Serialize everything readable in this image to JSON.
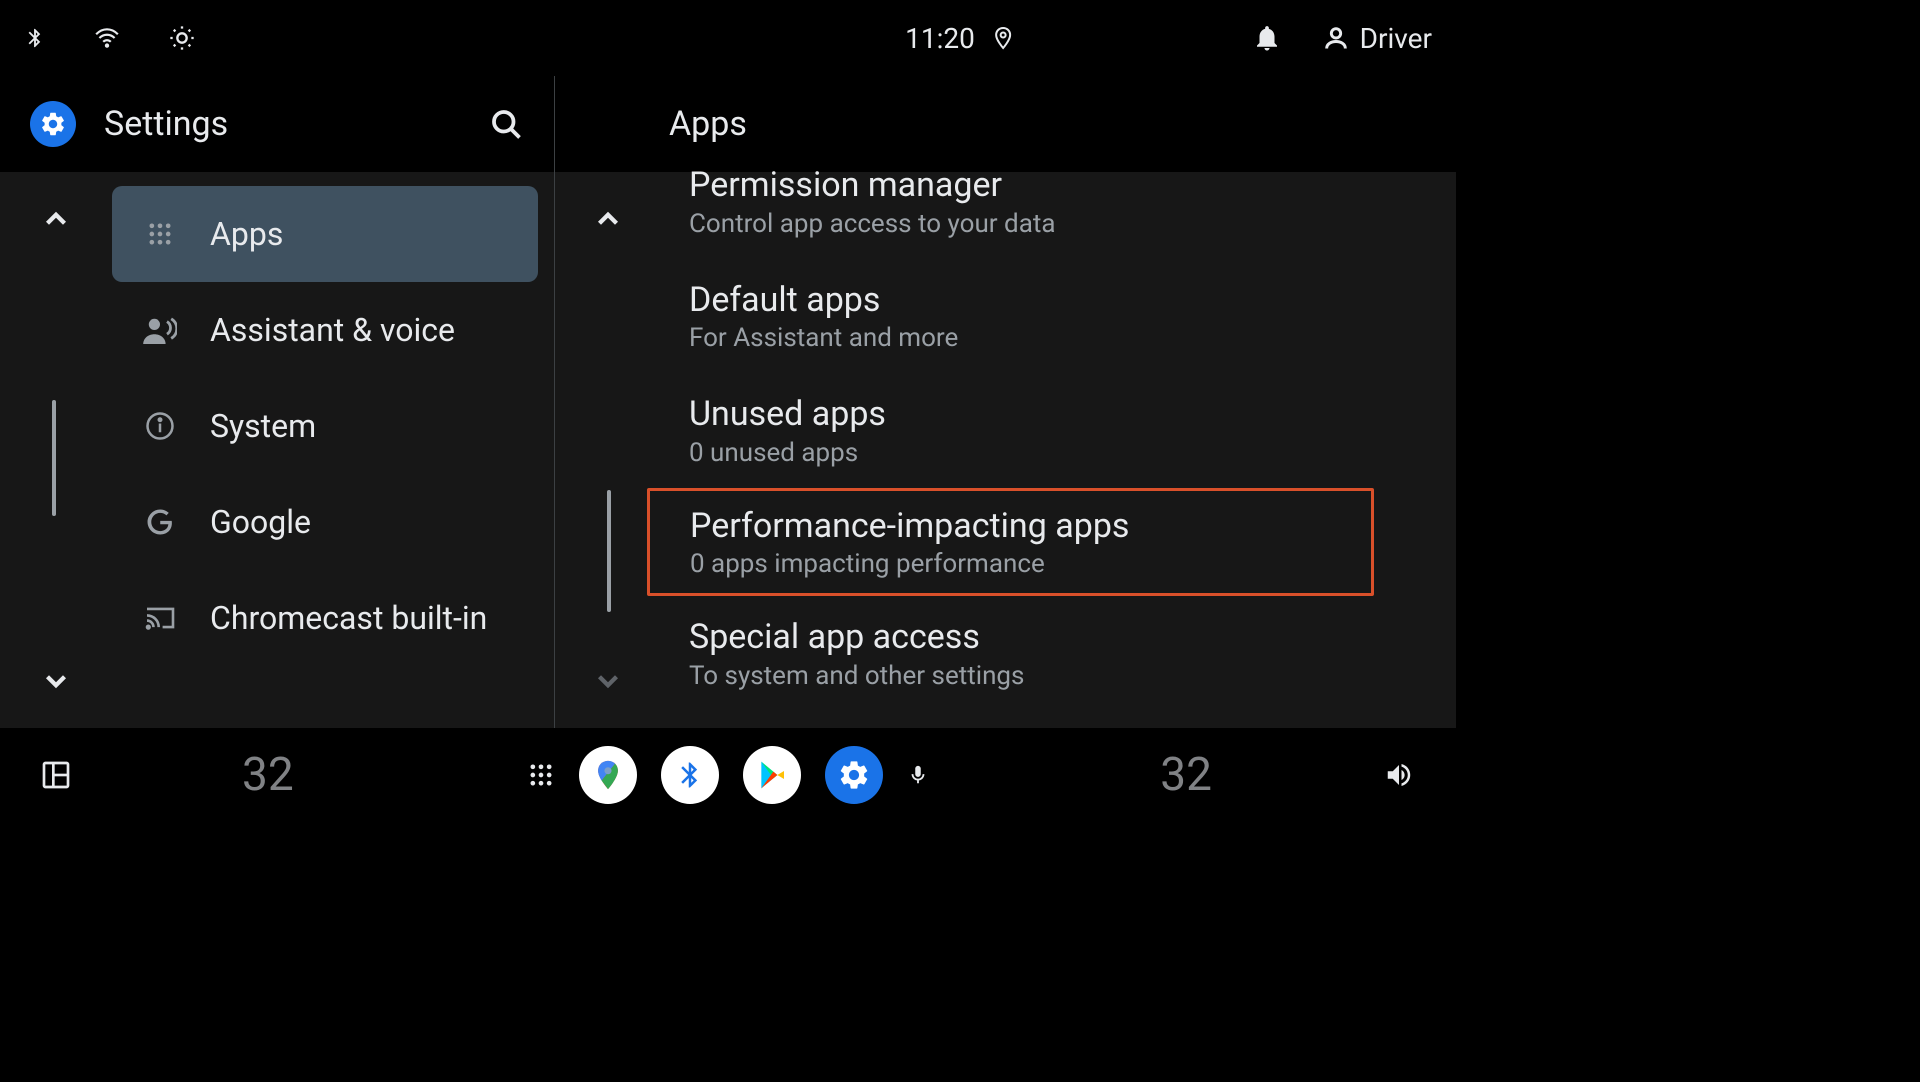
{
  "status": {
    "time": "11:20",
    "user": "Driver"
  },
  "left": {
    "title": "Settings",
    "items": [
      {
        "label": "Apps",
        "icon": "apps-grid-icon",
        "selected": true
      },
      {
        "label": "Assistant & voice",
        "icon": "assistant-voice-icon",
        "selected": false
      },
      {
        "label": "System",
        "icon": "info-icon",
        "selected": false
      },
      {
        "label": "Google",
        "icon": "google-g-icon",
        "selected": false
      },
      {
        "label": "Chromecast built-in",
        "icon": "cast-icon",
        "selected": false
      }
    ]
  },
  "right": {
    "title": "Apps",
    "items": [
      {
        "title": "Permission manager",
        "sub": "Control app access to your data"
      },
      {
        "title": "Default apps",
        "sub": "For Assistant and more"
      },
      {
        "title": "Unused apps",
        "sub": "0 unused apps"
      },
      {
        "title": "Performance-impacting apps",
        "sub": "0 apps impacting performance",
        "highlighted": true
      },
      {
        "title": "Special app access",
        "sub": "To system and other settings"
      }
    ]
  },
  "bottom": {
    "temp_left": "32",
    "temp_right": "32"
  }
}
